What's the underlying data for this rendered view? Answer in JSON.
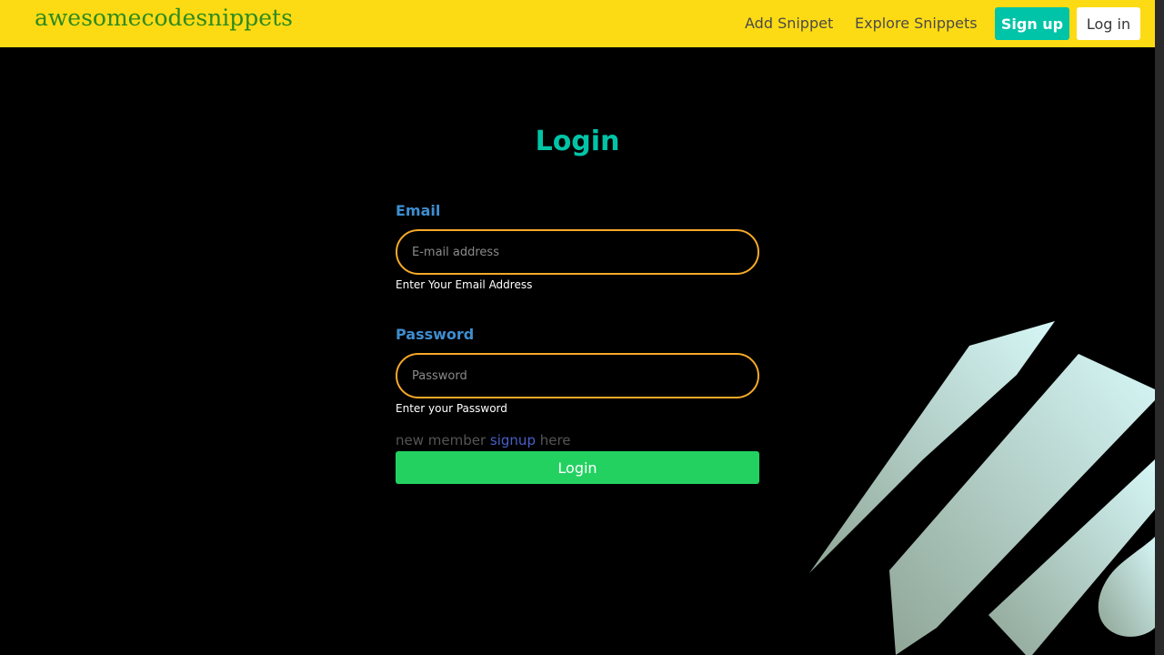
{
  "navbar": {
    "brand": "awesomecodesnippets",
    "links": {
      "add_snippet": "Add Snippet",
      "explore_snippets": "Explore Snippets"
    },
    "signup_label": "Sign up",
    "login_label": "Log in"
  },
  "login_form": {
    "title": "Login",
    "email": {
      "label": "Email",
      "placeholder": "E-mail address",
      "value": "",
      "help": "Enter Your Email Address"
    },
    "password": {
      "label": "Password",
      "placeholder": "Password",
      "value": "",
      "help": "Enter your Password"
    },
    "signup_prompt": {
      "before": "new member ",
      "link": "signup",
      "after": " here"
    },
    "submit_label": "Login"
  },
  "colors": {
    "navbar_bg": "#fddb14",
    "brand": "#2f8a1d",
    "primary": "#00c4a7",
    "label": "#3e8ed0",
    "input_border": "#f7a928",
    "submit": "#23d160",
    "link": "#485fc7",
    "background": "#000000"
  }
}
